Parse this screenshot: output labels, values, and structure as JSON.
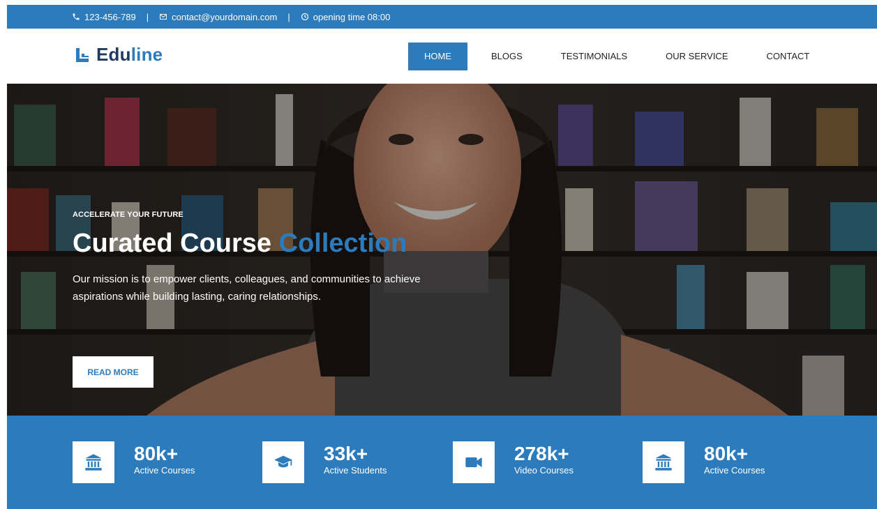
{
  "topbar": {
    "phone": "123-456-789",
    "email": "contact@yourdomain.com",
    "hours": "opening time 08:00",
    "separator": "|"
  },
  "brand": {
    "name_part1": "Edu",
    "name_part2": "line"
  },
  "nav": {
    "items": [
      {
        "label": "HOME",
        "active": true
      },
      {
        "label": "BLOGS",
        "active": false
      },
      {
        "label": "TESTIMONIALS",
        "active": false
      },
      {
        "label": "OUR SERVICE",
        "active": false
      },
      {
        "label": "CONTACT",
        "active": false
      }
    ]
  },
  "hero": {
    "kicker": "ACCELERATE YOUR FUTURE",
    "title_part1": "Curated Course",
    "title_part2": "Collection",
    "description": "Our mission is to empower clients, colleagues, and communities to achieve aspirations while building lasting, caring relationships.",
    "cta": "READ MORE"
  },
  "stats": [
    {
      "value": "80k+",
      "label": "Active Courses",
      "icon": "bank-icon"
    },
    {
      "value": "33k+",
      "label": "Active Students",
      "icon": "graduation-cap-icon"
    },
    {
      "value": "278k+",
      "label": "Video Courses",
      "icon": "video-camera-icon"
    },
    {
      "value": "80k+",
      "label": "Active Courses",
      "icon": "bank-icon"
    }
  ],
  "colors": {
    "accent": "#2b7bbd",
    "dark": "#1f3a5f"
  }
}
